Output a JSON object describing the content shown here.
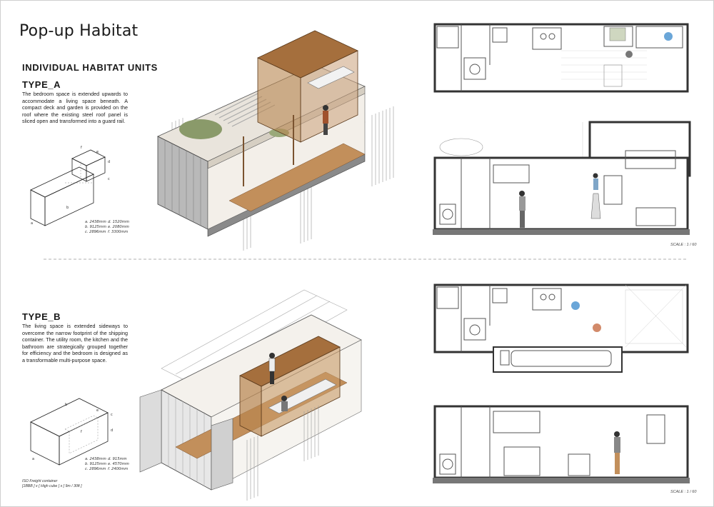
{
  "title": "Pop-up Habitat",
  "section_heading": "INDIVIDUAL HABITAT UNITS",
  "type_a": {
    "heading": "TYPE_A",
    "description": "The bedroom space is extended upwards to accommodate a living space beneath. A compact deck and garden is provided on the roof where the existing steel roof panel is sliced open and transformed into a guard rail.",
    "dims_left": [
      "a. 2438mm",
      "b. 9125mm",
      "c. 2896mm"
    ],
    "dims_right": [
      "d. 1520mm",
      "e. 2080mm",
      "f. 3300mm"
    ],
    "box_labels": [
      "a",
      "b",
      "c",
      "d",
      "e",
      "f"
    ]
  },
  "type_b": {
    "heading": "TYPE_B",
    "description": "The living space is extended sideways to overcome the narrow footprint of the shipping container. The utility room, the kitchen and the bathroom are strategically grouped together for efficiency and the bedroom is designed as a transformable multi-purpose space.",
    "dims_left": [
      "a. 2438mm",
      "b. 9125mm",
      "c. 2896mm"
    ],
    "dims_right": [
      "d. 915mm",
      "e. 4570mm",
      "f. 2400mm"
    ],
    "box_labels": [
      "a",
      "b",
      "c",
      "d",
      "e",
      "f"
    ]
  },
  "iso_note": [
    "ISO Freight container",
    "[1BBB ] x [ High cube ] x [ 9m / 30ft ]"
  ],
  "scale_a": "SCALE : 1 / 60",
  "scale_b": "SCALE : 1 / 60",
  "colors": {
    "wood": "#b07a45",
    "wood_light": "#d3a877",
    "steel": "#9a9a9a",
    "wall": "#555555",
    "plant": "#8a9a6a"
  }
}
